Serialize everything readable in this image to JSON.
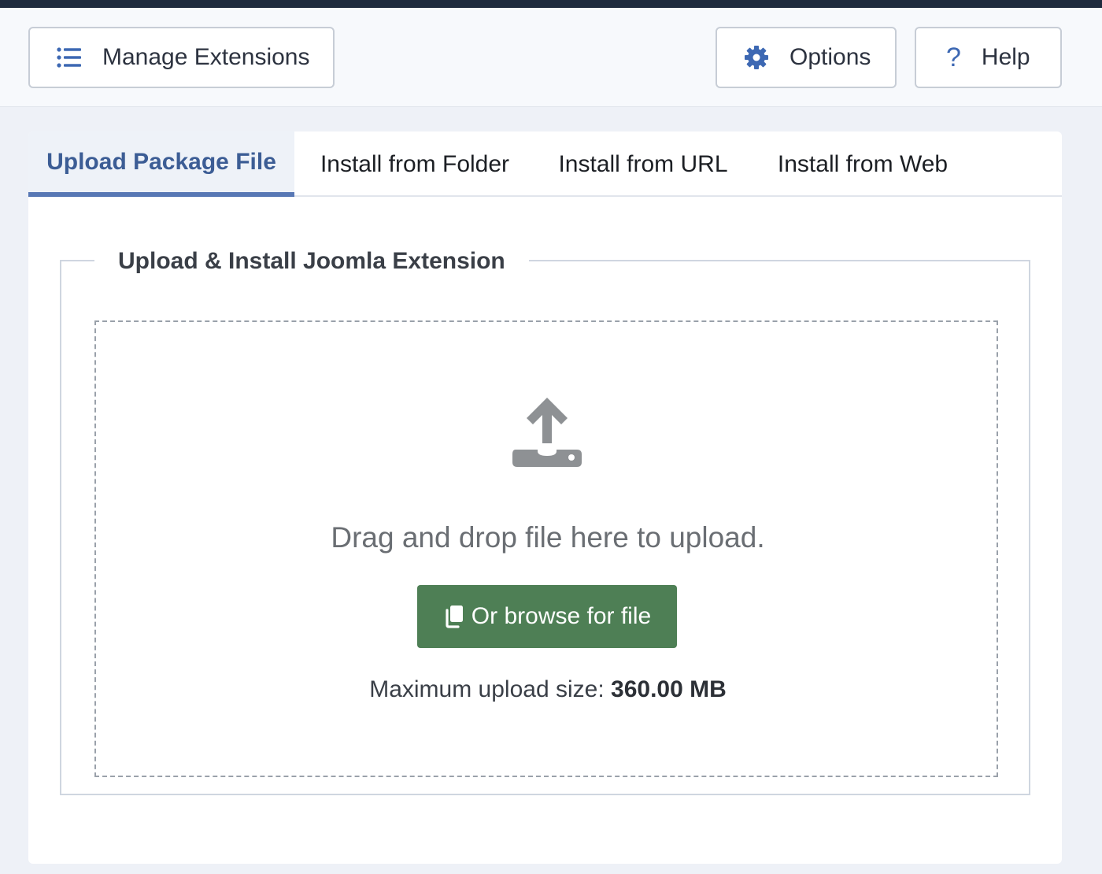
{
  "toolbar": {
    "manage_label": "Manage Extensions",
    "options_label": "Options",
    "help_label": "Help",
    "help_glyph": "?",
    "icons": {
      "manage": "list-icon",
      "options": "gear-icon",
      "help": "question-icon"
    }
  },
  "tabs": [
    {
      "label": "Upload Package File",
      "active": true
    },
    {
      "label": "Install from Folder",
      "active": false
    },
    {
      "label": "Install from URL",
      "active": false
    },
    {
      "label": "Install from Web",
      "active": false
    }
  ],
  "upload": {
    "legend": "Upload & Install Joomla Extension",
    "drag_text": "Drag and drop file here to upload.",
    "browse_label": "Or browse for file",
    "max_label": "Maximum upload size:",
    "max_value": "360.00 MB",
    "icons": {
      "dropzone": "upload-icon",
      "browse": "copy-icon"
    }
  },
  "colors": {
    "accent": "#3c5d95",
    "success": "#4e7f55",
    "header_strip": "#1f2b3e"
  }
}
